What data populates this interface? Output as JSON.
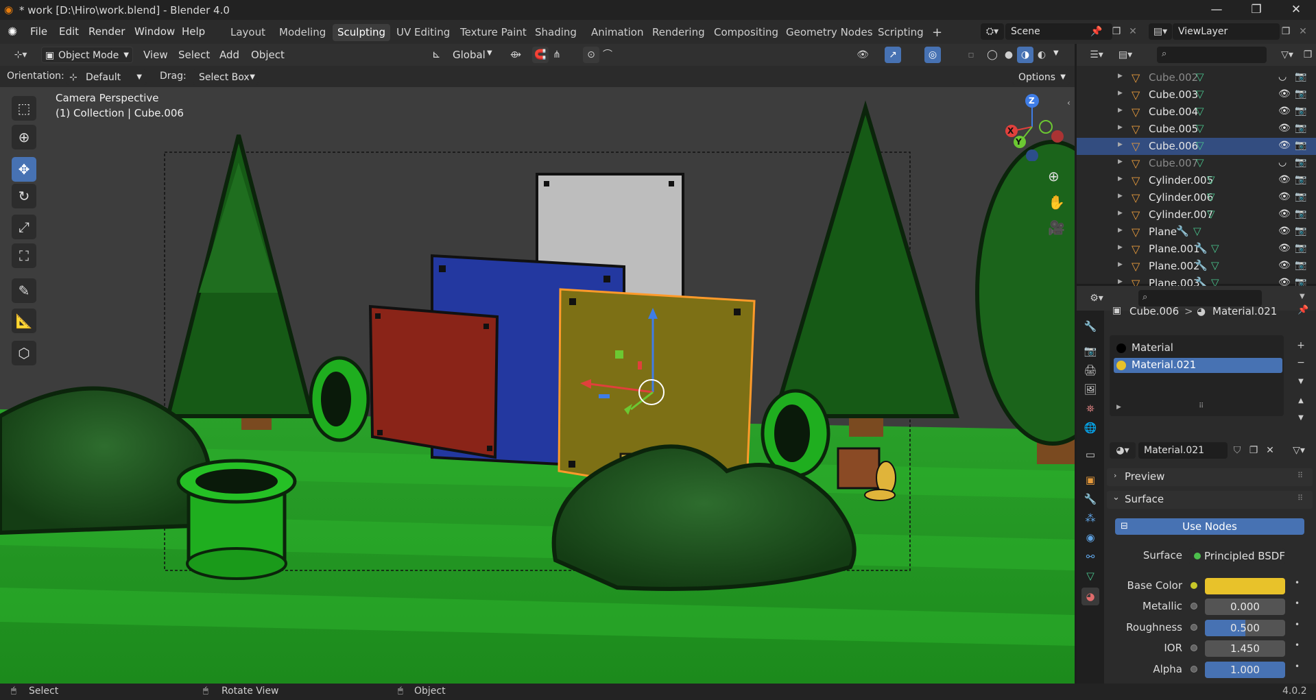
{
  "window": {
    "title": "* work [D:\\Hiro\\work.blend] - Blender 4.0",
    "minimize": "—",
    "maximize": "❐",
    "close": "✕"
  },
  "menu": [
    "File",
    "Edit",
    "Render",
    "Window",
    "Help"
  ],
  "workspaces": [
    "Layout",
    "Modeling",
    "Sculpting",
    "UV Editing",
    "Texture Paint",
    "Shading",
    "Animation",
    "Rendering",
    "Compositing",
    "Geometry Nodes",
    "Scripting"
  ],
  "active_workspace": "Sculpting",
  "add_workspace": "+",
  "scene": {
    "name": "Scene"
  },
  "view_layer": {
    "name": "ViewLayer"
  },
  "viewport_header": {
    "mode": "Object Mode",
    "menus": [
      "View",
      "Select",
      "Add",
      "Object"
    ],
    "transform_orientation": "Global"
  },
  "tool_settings": {
    "orientation_label": "Orientation:",
    "orientation_value": "Default",
    "drag_label": "Drag:",
    "drag_value": "Select Box",
    "options": "Options"
  },
  "viewport": {
    "camera_label": "Camera Perspective",
    "collection_label": "(1) Collection | Cube.006",
    "gizmo_axes": {
      "z": "Z",
      "y": "Y",
      "x": "X"
    }
  },
  "outliner": {
    "search_placeholder": "",
    "items": [
      {
        "name": "Cube.002",
        "dim": true,
        "selected": false,
        "modifier": false
      },
      {
        "name": "Cube.003",
        "dim": false,
        "selected": false,
        "modifier": false
      },
      {
        "name": "Cube.004",
        "dim": false,
        "selected": false,
        "modifier": false
      },
      {
        "name": "Cube.005",
        "dim": false,
        "selected": false,
        "modifier": false
      },
      {
        "name": "Cube.006",
        "dim": false,
        "selected": true,
        "modifier": false
      },
      {
        "name": "Cube.007",
        "dim": true,
        "selected": false,
        "modifier": false
      },
      {
        "name": "Cylinder.005",
        "dim": false,
        "selected": false,
        "modifier": false
      },
      {
        "name": "Cylinder.006",
        "dim": false,
        "selected": false,
        "modifier": false
      },
      {
        "name": "Cylinder.007",
        "dim": false,
        "selected": false,
        "modifier": false
      },
      {
        "name": "Plane",
        "dim": false,
        "selected": false,
        "modifier": true
      },
      {
        "name": "Plane.001",
        "dim": false,
        "selected": false,
        "modifier": true
      },
      {
        "name": "Plane.002",
        "dim": false,
        "selected": false,
        "modifier": true
      },
      {
        "name": "Plane.003",
        "dim": false,
        "selected": false,
        "modifier": true
      }
    ]
  },
  "properties": {
    "breadcrumb_object": "Cube.006",
    "breadcrumb_sep": ">",
    "breadcrumb_material": "Material.021",
    "material_slots": [
      "Material",
      "Material.021"
    ],
    "active_slot": "Material.021",
    "material_name": "Material.021",
    "preview_label": "Preview",
    "surface_label": "Surface",
    "use_nodes": "Use Nodes",
    "surface_field_label": "Surface",
    "surface_shader": "Principled BSDF",
    "fields": [
      {
        "label": "Base Color",
        "value": "",
        "color": "#e8c22a"
      },
      {
        "label": "Metallic",
        "value": "0.000",
        "fraction": 0.0
      },
      {
        "label": "Roughness",
        "value": "0.500",
        "fraction": 0.5
      },
      {
        "label": "IOR",
        "value": "1.450",
        "fraction": 0.0
      },
      {
        "label": "Alpha",
        "value": "1.000",
        "fraction": 1.0
      }
    ]
  },
  "statusbar": {
    "select": "Select",
    "rotate": "Rotate View",
    "object": "Object",
    "version": "4.0.2"
  },
  "colors": {
    "accent": "#4772b3",
    "selection_outline": "#ff9a2a",
    "mesh_icon": "#49c38c",
    "object_icon": "#e69a3c"
  }
}
